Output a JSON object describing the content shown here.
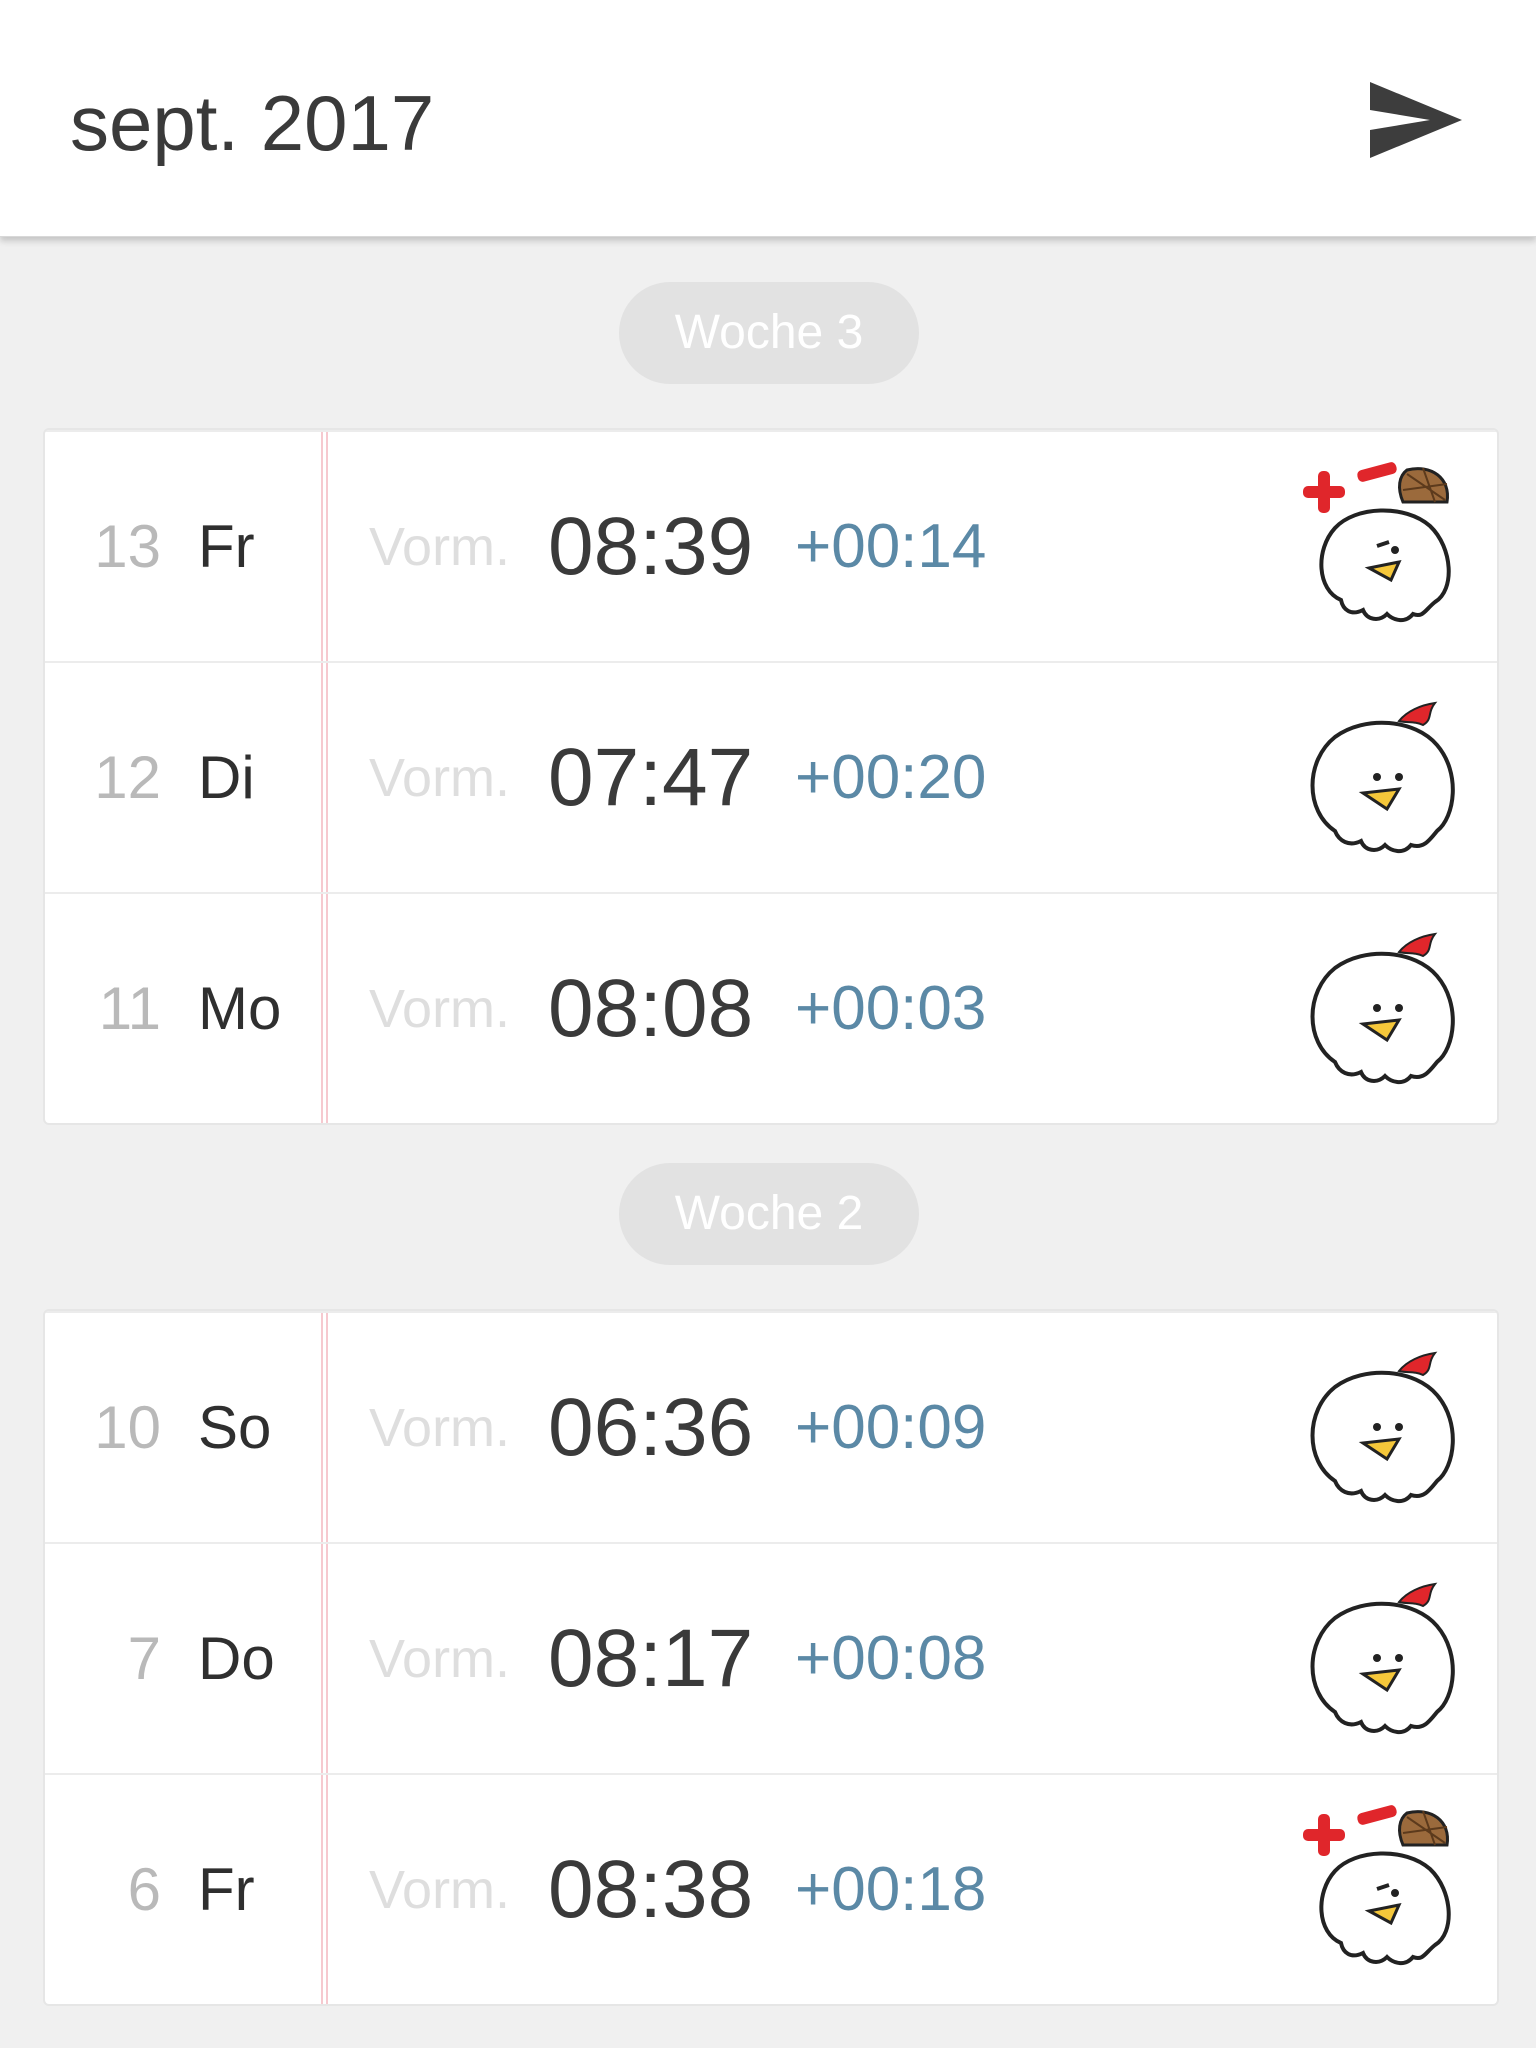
{
  "header": {
    "title": "sept. 2017",
    "send_icon": "send-icon"
  },
  "weeks": [
    {
      "label": "Woche 3",
      "days": [
        {
          "num": "13",
          "name": "Fr",
          "period": "Vorm.",
          "time": "08:39",
          "diff": "+00:14",
          "mood": "detective"
        },
        {
          "num": "12",
          "name": "Di",
          "period": "Vorm.",
          "time": "07:47",
          "diff": "+00:20",
          "mood": "normal"
        },
        {
          "num": "11",
          "name": "Mo",
          "period": "Vorm.",
          "time": "08:08",
          "diff": "+00:03",
          "mood": "normal"
        }
      ]
    },
    {
      "label": "Woche 2",
      "days": [
        {
          "num": "10",
          "name": "So",
          "period": "Vorm.",
          "time": "06:36",
          "diff": "+00:09",
          "mood": "normal"
        },
        {
          "num": "7",
          "name": "Do",
          "period": "Vorm.",
          "time": "08:17",
          "diff": "+00:08",
          "mood": "normal"
        },
        {
          "num": "6",
          "name": "Fr",
          "period": "Vorm.",
          "time": "08:38",
          "diff": "+00:18",
          "mood": "detective"
        }
      ]
    }
  ],
  "colors": {
    "accent_diff": "#5b89a6",
    "redline": "#f6c9cf",
    "background": "#f0f0f0"
  }
}
